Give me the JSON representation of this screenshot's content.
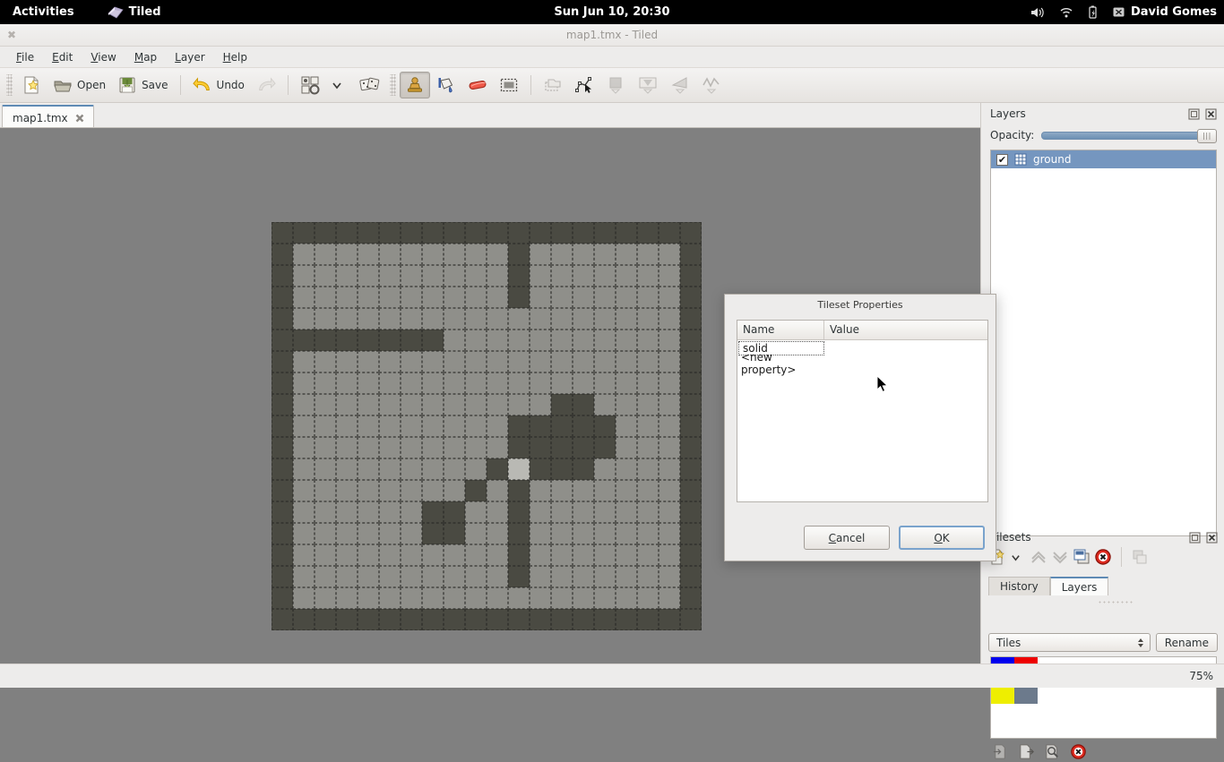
{
  "gnome": {
    "activities": "Activities",
    "app_name": "Tiled",
    "clock": "Sun Jun 10, 20:30",
    "user": "David Gomes",
    "tray_icons": [
      "volume-icon",
      "wifi-icon",
      "battery-icon"
    ]
  },
  "window": {
    "title": "map1.tmx - Tiled",
    "close_glyph": "✖"
  },
  "menubar": {
    "items": [
      {
        "label": "File",
        "accel": "F"
      },
      {
        "label": "Edit",
        "accel": "E"
      },
      {
        "label": "View",
        "accel": "V"
      },
      {
        "label": "Map",
        "accel": "M"
      },
      {
        "label": "Layer",
        "accel": "L"
      },
      {
        "label": "Help",
        "accel": "H"
      }
    ]
  },
  "toolbar": {
    "new_label": "",
    "open_label": "Open",
    "save_label": "Save",
    "undo_label": "Undo",
    "redo_label": "",
    "items": [
      "new-icon",
      "open-icon",
      "save-icon",
      "undo-icon",
      "redo-icon",
      "tileset-properties-icon",
      "chevron-down-icon",
      "random-mode-icon",
      "stamp-brush-icon",
      "bucket-fill-icon",
      "eraser-icon",
      "rectangle-select-icon",
      "select-object-icon",
      "edit-polygons-icon",
      "insert-rectangle-icon",
      "insert-tile-icon",
      "insert-polygon-icon",
      "insert-polyline-icon"
    ]
  },
  "tabs": {
    "documents": [
      {
        "label": "map1.tmx",
        "close_glyph": "✖",
        "active": true
      }
    ]
  },
  "layers_panel": {
    "title": "Layers",
    "opacity_label": "Opacity:",
    "opacity_value": 100,
    "layers": [
      {
        "name": "ground",
        "visible": true,
        "selected": true
      }
    ],
    "tool_icons": [
      "new-layer-icon",
      "chevron-down-icon",
      "raise-layer-icon",
      "lower-layer-icon",
      "duplicate-layer-icon",
      "remove-layer-icon",
      "layer-properties-icon"
    ],
    "float_icon": "float-panel-icon",
    "close_icon": "close-panel-icon"
  },
  "panel_tabs": {
    "items": [
      {
        "label": "History",
        "active": false
      },
      {
        "label": "Layers",
        "active": true
      }
    ]
  },
  "tilesets_panel": {
    "title": "Tilesets",
    "selected_tileset": "Tiles",
    "rename_label": "Rename",
    "tiles": [
      {
        "name": "tile-blue",
        "color": "#0000ee"
      },
      {
        "name": "tile-red",
        "color": "#ee0000"
      },
      {
        "name": "tile-yellow",
        "color": "#eeee00"
      },
      {
        "name": "tile-slate",
        "color": "#6c7a8c"
      }
    ],
    "tool_icons": [
      "import-tileset-icon",
      "export-tileset-icon",
      "tileset-properties-icon",
      "remove-tileset-icon"
    ],
    "float_icon": "float-panel-icon",
    "close_icon": "close-panel-icon"
  },
  "statusbar": {
    "zoom": "75%"
  },
  "dialog": {
    "title": "Tileset Properties",
    "columns": [
      "Name",
      "Value"
    ],
    "rows": [
      {
        "name": "solid",
        "value": "",
        "editing": true
      },
      {
        "name": "<new property>",
        "value": "",
        "editing": false
      }
    ],
    "cancel_label": "Cancel",
    "cancel_accel": "C",
    "ok_label": "OK",
    "ok_accel": "O"
  },
  "map": {
    "columns": 20,
    "rows": 19,
    "tile_size": 24,
    "legend": {
      "0": "floor",
      "1": "wall",
      "2": "light-floor"
    },
    "grid": [
      [
        1,
        1,
        1,
        1,
        1,
        1,
        1,
        1,
        1,
        1,
        1,
        1,
        1,
        1,
        1,
        1,
        1,
        1,
        1,
        1
      ],
      [
        1,
        0,
        0,
        0,
        0,
        0,
        0,
        0,
        0,
        0,
        0,
        1,
        0,
        0,
        0,
        0,
        0,
        0,
        0,
        1
      ],
      [
        1,
        0,
        0,
        0,
        0,
        0,
        0,
        0,
        0,
        0,
        0,
        1,
        0,
        0,
        0,
        0,
        0,
        0,
        0,
        1
      ],
      [
        1,
        0,
        0,
        0,
        0,
        0,
        0,
        0,
        0,
        0,
        0,
        1,
        0,
        0,
        0,
        0,
        0,
        0,
        0,
        1
      ],
      [
        1,
        0,
        0,
        0,
        0,
        0,
        0,
        0,
        0,
        0,
        0,
        0,
        0,
        0,
        0,
        0,
        0,
        0,
        0,
        1
      ],
      [
        1,
        1,
        1,
        1,
        1,
        1,
        1,
        1,
        0,
        0,
        0,
        0,
        0,
        0,
        0,
        0,
        0,
        0,
        0,
        1
      ],
      [
        1,
        0,
        0,
        0,
        0,
        0,
        0,
        0,
        0,
        0,
        0,
        0,
        0,
        0,
        0,
        0,
        0,
        0,
        0,
        1
      ],
      [
        1,
        0,
        0,
        0,
        0,
        0,
        0,
        0,
        0,
        0,
        0,
        0,
        0,
        0,
        0,
        0,
        0,
        0,
        0,
        1
      ],
      [
        1,
        0,
        0,
        0,
        0,
        0,
        0,
        0,
        0,
        0,
        0,
        0,
        0,
        1,
        1,
        0,
        0,
        0,
        0,
        1
      ],
      [
        1,
        0,
        0,
        0,
        0,
        0,
        0,
        0,
        0,
        0,
        0,
        1,
        1,
        1,
        1,
        1,
        0,
        0,
        0,
        1
      ],
      [
        1,
        0,
        0,
        0,
        0,
        0,
        0,
        0,
        0,
        0,
        0,
        1,
        1,
        1,
        1,
        1,
        0,
        0,
        0,
        1
      ],
      [
        1,
        0,
        0,
        0,
        0,
        0,
        0,
        0,
        0,
        0,
        1,
        2,
        1,
        1,
        1,
        0,
        0,
        0,
        0,
        1
      ],
      [
        1,
        0,
        0,
        0,
        0,
        0,
        0,
        0,
        0,
        1,
        0,
        1,
        0,
        0,
        0,
        0,
        0,
        0,
        0,
        1
      ],
      [
        1,
        0,
        0,
        0,
        0,
        0,
        0,
        1,
        1,
        0,
        0,
        1,
        0,
        0,
        0,
        0,
        0,
        0,
        0,
        1
      ],
      [
        1,
        0,
        0,
        0,
        0,
        0,
        0,
        1,
        1,
        0,
        0,
        1,
        0,
        0,
        0,
        0,
        0,
        0,
        0,
        1
      ],
      [
        1,
        0,
        0,
        0,
        0,
        0,
        0,
        0,
        0,
        0,
        0,
        1,
        0,
        0,
        0,
        0,
        0,
        0,
        0,
        1
      ],
      [
        1,
        0,
        0,
        0,
        0,
        0,
        0,
        0,
        0,
        0,
        0,
        1,
        0,
        0,
        0,
        0,
        0,
        0,
        0,
        1
      ],
      [
        1,
        0,
        0,
        0,
        0,
        0,
        0,
        0,
        0,
        0,
        0,
        0,
        0,
        0,
        0,
        0,
        0,
        0,
        0,
        1
      ],
      [
        1,
        1,
        1,
        1,
        1,
        1,
        1,
        1,
        1,
        1,
        1,
        1,
        1,
        1,
        1,
        1,
        1,
        1,
        1,
        1
      ]
    ]
  }
}
